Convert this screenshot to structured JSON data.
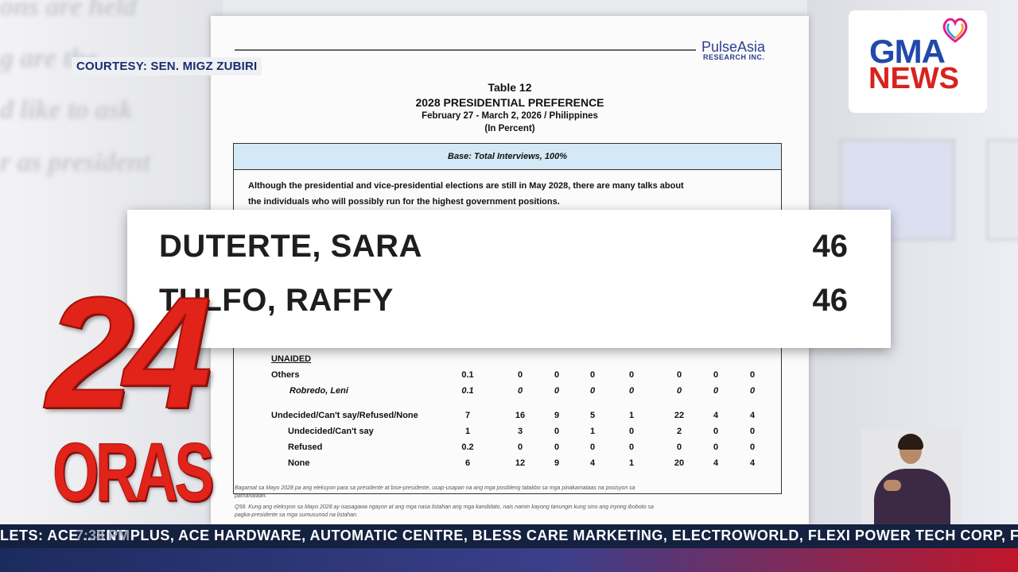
{
  "courtesy": "COURTESY: SEN. MIGZ ZUBIRI",
  "document": {
    "brand_name": "PulseAsia",
    "brand_sub": "RESEARCH INC.",
    "table_no": "Table 12",
    "title": "2028 PRESIDENTIAL PREFERENCE",
    "date": "February 27 - March 2, 2026 / Philippines",
    "unit": "(In Percent)",
    "base": "Base: Total Interviews, 100%",
    "intro_line1": "Although the presidential and vice-presidential elections are still in May 2028, there are many talks about",
    "intro_line2": "the individuals who will  possibly run for the highest government positions.",
    "section": "UNAIDED",
    "rows": [
      {
        "label": "Others",
        "values": [
          "0.1",
          "0",
          "0",
          "0",
          "0",
          "0",
          "0",
          "0"
        ],
        "indent": 0,
        "italic": false
      },
      {
        "label": "Robredo, Leni",
        "values": [
          "0.1",
          "0",
          "0",
          "0",
          "0",
          "0",
          "0",
          "0"
        ],
        "indent": 2,
        "italic": true
      },
      {
        "label": "Undecided/Can't say/Refused/None",
        "values": [
          "7",
          "16",
          "9",
          "5",
          "1",
          "22",
          "4",
          "4"
        ],
        "indent": 0,
        "italic": false
      },
      {
        "label": "Undecided/Can't say",
        "values": [
          "1",
          "3",
          "0",
          "1",
          "0",
          "2",
          "0",
          "0"
        ],
        "indent": 1,
        "italic": false
      },
      {
        "label": "Refused",
        "values": [
          "0.2",
          "0",
          "0",
          "0",
          "0",
          "0",
          "0",
          "0"
        ],
        "indent": 1,
        "italic": false
      },
      {
        "label": "None",
        "values": [
          "6",
          "12",
          "9",
          "4",
          "1",
          "20",
          "4",
          "4"
        ],
        "indent": 1,
        "italic": false
      }
    ],
    "footnote1": "Bagamat sa Mayo 2028 pa ang eleksyon para sa presidente at bise-presidente, usap-usapan na ang mga posibleng tatakbo sa mga pinakamataas na posisyon sa",
    "footnote2": "pamahalaan.",
    "footnote3": "Q58. Kung ang eleksyon sa Mayo 2028 ay isasagawa ngayon at ang mga nasa listahan ang mga kandidato, nais namin kayong tanungin kung sino ang inyong iboboto sa",
    "footnote4": "pagka-presidente sa mga sumusunod na listahan."
  },
  "highlight": {
    "rows": [
      {
        "name": "DUTERTE, SARA",
        "value": "46"
      },
      {
        "name": "TULFO, RAFFY",
        "value": "46"
      }
    ]
  },
  "network": {
    "top": "GMA",
    "bottom": "NEWS"
  },
  "show": {
    "number": "24",
    "word": "ORAS"
  },
  "ticker": {
    "text": "LETS: ACE ...ENT PLUS, ACE HARDWARE, AUTOMATIC CENTRE, BLESS CARE MARKETING, ELECTROWORLD, FLEXI POWER TECH CORP, F",
    "time": "7:38 PM"
  },
  "colors": {
    "brand_red": "#e2231a",
    "brand_blue": "#1f4aa8",
    "ticker_bg": "#14213f",
    "base_bg": "#d5e8f5"
  }
}
